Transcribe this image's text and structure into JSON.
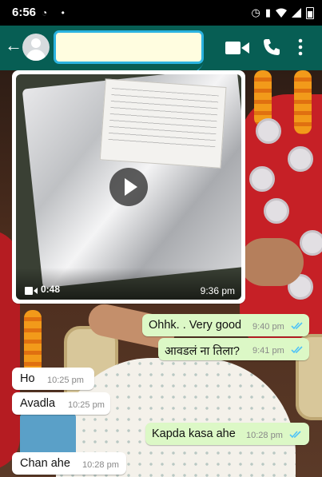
{
  "status_bar": {
    "time": "6:56",
    "left_icons": [
      "whatsapp-icon",
      "dot-icon"
    ],
    "right_icons": [
      "alarm-icon",
      "vibrate-icon",
      "wifi-icon",
      "signal-icon",
      "battery-icon"
    ]
  },
  "header": {
    "contact_name": "",
    "actions": [
      "video-call",
      "voice-call",
      "more-options"
    ]
  },
  "colors": {
    "header": "#075e54",
    "outgoing_bubble": "#dcf8c6",
    "incoming_bubble": "#ffffff",
    "read_ticks": "#4fc3f7",
    "name_highlight": "#2bb3e0"
  },
  "video_message": {
    "duration": "0:48",
    "time": "9:36 pm"
  },
  "messages": [
    {
      "direction": "out",
      "text": "Ohhk. . Very good",
      "time": "9:40 pm",
      "status": "read"
    },
    {
      "direction": "out",
      "text": "आवडलं ना तिला?",
      "time": "9:41 pm",
      "status": "read"
    },
    {
      "direction": "in",
      "text": "Ho",
      "time": "10:25 pm"
    },
    {
      "direction": "in",
      "text": "Avadla",
      "time": "10:25 pm"
    },
    {
      "direction": "out",
      "text": "Kapda kasa ahe",
      "time": "10:28 pm",
      "status": "read"
    },
    {
      "direction": "in",
      "text": "Chan ahe",
      "time": "10:28 pm"
    }
  ]
}
